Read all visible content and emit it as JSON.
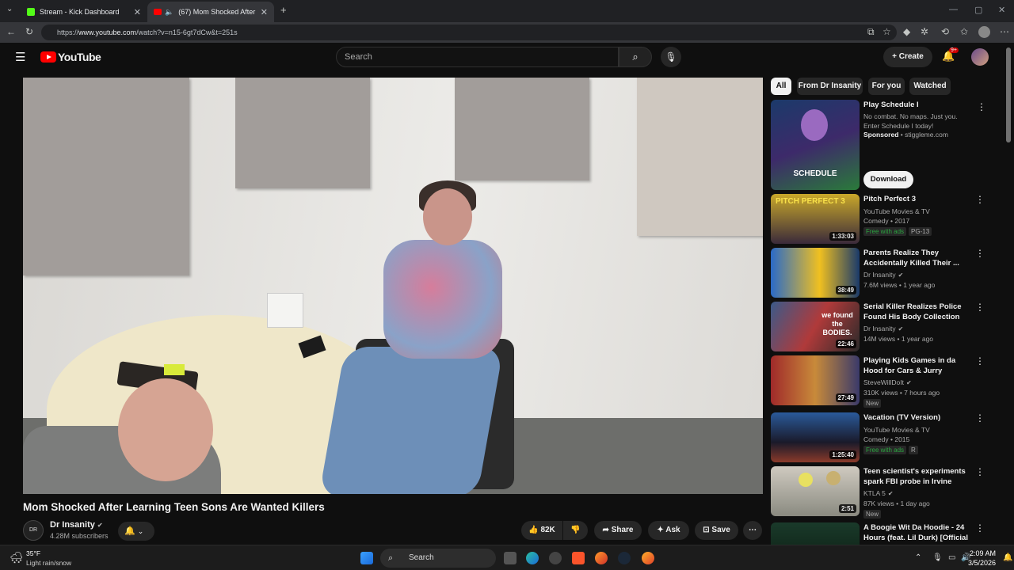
{
  "browser": {
    "tabs": [
      {
        "title": "Stream - Kick Dashboard",
        "icon": "kick-icon"
      },
      {
        "title": "(67) Mom Shocked After Lear",
        "icon": "youtube-icon"
      }
    ],
    "url_prefix": "https://",
    "url_domain": "www.youtube.com",
    "url_path": "/watch?v=n15-6gt7dCw&t=251s"
  },
  "header": {
    "logo": "YouTube",
    "search_placeholder": "Search",
    "create_label": "Create",
    "notification_badge": "9+"
  },
  "video": {
    "title": "Mom Shocked After Learning Teen Sons Are Wanted Killers",
    "channel": "Dr Insanity",
    "subscribers": "4.28M subscribers",
    "channel_avatar_text": "DR",
    "likes": "82K",
    "share_label": "Share",
    "ask_label": "Ask",
    "save_label": "Save"
  },
  "chips": [
    "All",
    "From Dr Insanity",
    "For you",
    "Watched"
  ],
  "sponsored": {
    "title": "Play Schedule I",
    "desc": "No combat. No maps. Just you. Enter Schedule I today!",
    "sponsor_label": "Sponsored",
    "sponsor_site": "stiggleme.com",
    "thumb_text": "SCHEDULE",
    "download_label": "Download"
  },
  "recommendations": [
    {
      "title": "Pitch Perfect 3",
      "channel": "YouTube Movies & TV",
      "meta": "Comedy • 2017",
      "duration": "1:33:03",
      "tags": [
        "Free with ads",
        "PG-13"
      ],
      "thumb_text": "PITCH PERFECT 3"
    },
    {
      "title": "Parents Realize They Accidentally Killed Their ...",
      "channel": "Dr Insanity",
      "meta": "7.6M views • 1 year ago",
      "duration": "38:49",
      "tags": [],
      "thumb_text": ""
    },
    {
      "title": "Serial Killer Realizes Police Found His Body Collection",
      "channel": "Dr Insanity",
      "meta": "14M views • 1 year ago",
      "duration": "22:46",
      "tags": [],
      "thumb_text": "we found the BODIES."
    },
    {
      "title": "Playing Kids Games in da Hood for Cars & Jurry",
      "channel": "SteveWillDoIt",
      "meta": "310K views • 7 hours ago",
      "duration": "27:49",
      "tags": [
        "New"
      ],
      "thumb_text": ""
    },
    {
      "title": "Vacation (TV Version)",
      "channel": "YouTube Movies & TV",
      "meta": "Comedy • 2015",
      "duration": "1:25:40",
      "tags": [
        "Free with ads",
        "R"
      ],
      "thumb_text": ""
    },
    {
      "title": "Teen scientist's experiments spark FBI probe in Irvine",
      "channel": "KTLA 5",
      "meta": "87K views • 1 day ago",
      "duration": "2:51",
      "tags": [
        "New"
      ],
      "thumb_text": ""
    },
    {
      "title": "A Boogie Wit Da Hoodie - 24 Hours (feat. Lil Durk) [Official ...",
      "channel": "",
      "meta": "",
      "duration": "",
      "tags": [],
      "thumb_text": ""
    }
  ],
  "taskbar": {
    "weather_temp": "35°F",
    "weather_desc": "Light rain/snow",
    "search_label": "Search",
    "time": "2:09 AM",
    "date": "3/5/2026"
  }
}
